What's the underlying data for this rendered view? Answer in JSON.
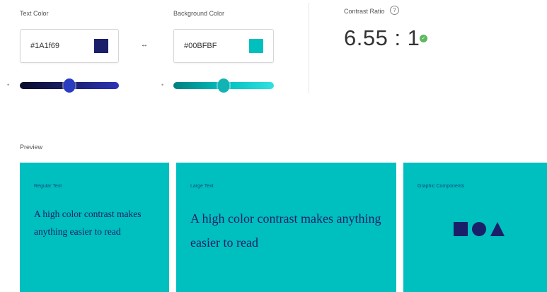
{
  "colors": {
    "text": "#1A1F69",
    "background": "#00BFBF",
    "success": "#5cb85c"
  },
  "text_color": {
    "label": "Text Color",
    "hex_value": "#1A1f69",
    "slider_marker": "•",
    "slider_level": 0.5
  },
  "swap": {
    "icon": "swap-arrows-icon",
    "glyph": "↔"
  },
  "background_color": {
    "label": "Background Color",
    "hex_value": "#00BFBF",
    "slider_marker": "•",
    "slider_level": 0.5
  },
  "contrast": {
    "label": "Contrast Ratio",
    "info_glyph": "?",
    "value": "6.55 : 1",
    "status_icon": "check-circle-icon",
    "status_glyph": "✓"
  },
  "preview": {
    "label": "Preview",
    "panels": [
      {
        "label": "Regular Text",
        "text": "A high color contrast makes anything easier to read"
      },
      {
        "label": "Large Text",
        "text": "A high color contrast makes anything easier to read"
      },
      {
        "label": "Graphic Components",
        "shapes": [
          "square",
          "circle",
          "triangle"
        ]
      }
    ]
  }
}
